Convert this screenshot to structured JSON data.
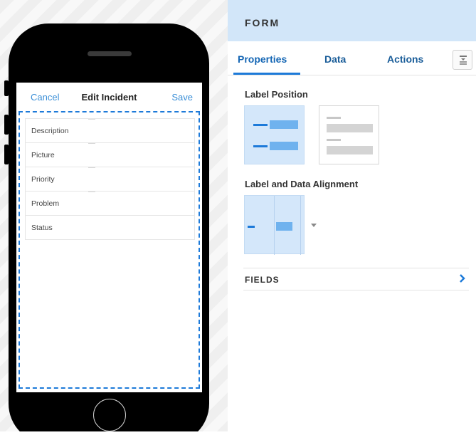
{
  "phone": {
    "nav": {
      "cancel": "Cancel",
      "title": "Edit Incident",
      "save": "Save"
    },
    "fields": [
      "Description",
      "Picture",
      "Priority",
      "Problem",
      "Status"
    ]
  },
  "panel": {
    "title": "FORM",
    "tabs": {
      "properties": "Properties",
      "data": "Data",
      "actions": "Actions",
      "active": "Properties"
    },
    "label_position_title": "Label Position",
    "label_position_selected": "left",
    "alignment_title": "Label and Data Alignment",
    "fields_title": "FIELDS"
  },
  "colors": {
    "accent": "#1d7ad9",
    "header_bg": "#d2e6f9",
    "selected_bg": "#d4e7fa",
    "link": "#3b8fd7"
  },
  "icons": [
    "tab-menu-icon",
    "dropdown-caret-icon",
    "chevron-right-icon"
  ]
}
